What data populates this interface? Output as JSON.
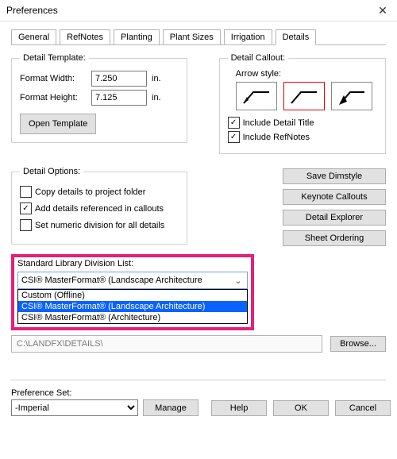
{
  "window_title": "Preferences",
  "tabs": [
    "General",
    "RefNotes",
    "Planting",
    "Plant Sizes",
    "Irrigation",
    "Details"
  ],
  "active_tab": 5,
  "detail_template": {
    "legend": "Detail Template:",
    "format_width_label": "Format Width:",
    "format_width_value": "7.250",
    "format_height_label": "Format Height:",
    "format_height_value": "7.125",
    "unit": "in.",
    "open_template_btn": "Open Template"
  },
  "detail_callout": {
    "legend": "Detail Callout:",
    "arrow_style_label": "Arrow style:",
    "include_detail_title_label": "Include Detail Title",
    "include_detail_title_checked": true,
    "include_refnotes_label": "Include RefNotes",
    "include_refnotes_checked": true
  },
  "detail_options": {
    "legend": "Detail Options:",
    "copy_label": "Copy details to project folder",
    "copy_checked": false,
    "add_label": "Add details referenced in callouts",
    "add_checked": true,
    "numeric_label": "Set numeric division for all details",
    "numeric_checked": false
  },
  "right_buttons": {
    "save_dimstyle": "Save Dimstyle",
    "keynote_callouts": "Keynote Callouts",
    "detail_explorer": "Detail Explorer",
    "sheet_ordering": "Sheet Ordering"
  },
  "stdlib": {
    "label": "Standard Library Division List:",
    "selected": "CSI® MasterFormat® (Landscape Architecture",
    "options": [
      "Custom (Offline)",
      "CSI® MasterFormat® (Landscape Architecture)",
      "CSI® MasterFormat® (Architecture)"
    ],
    "highlighted_index": 1
  },
  "path": {
    "value": "C:\\LANDFX\\DETAILS\\",
    "browse_btn": "Browse..."
  },
  "pref_set": {
    "label": "Preference Set:",
    "value": "-Imperial",
    "manage_btn": "Manage"
  },
  "buttons": {
    "help": "Help",
    "ok": "OK",
    "cancel": "Cancel"
  }
}
